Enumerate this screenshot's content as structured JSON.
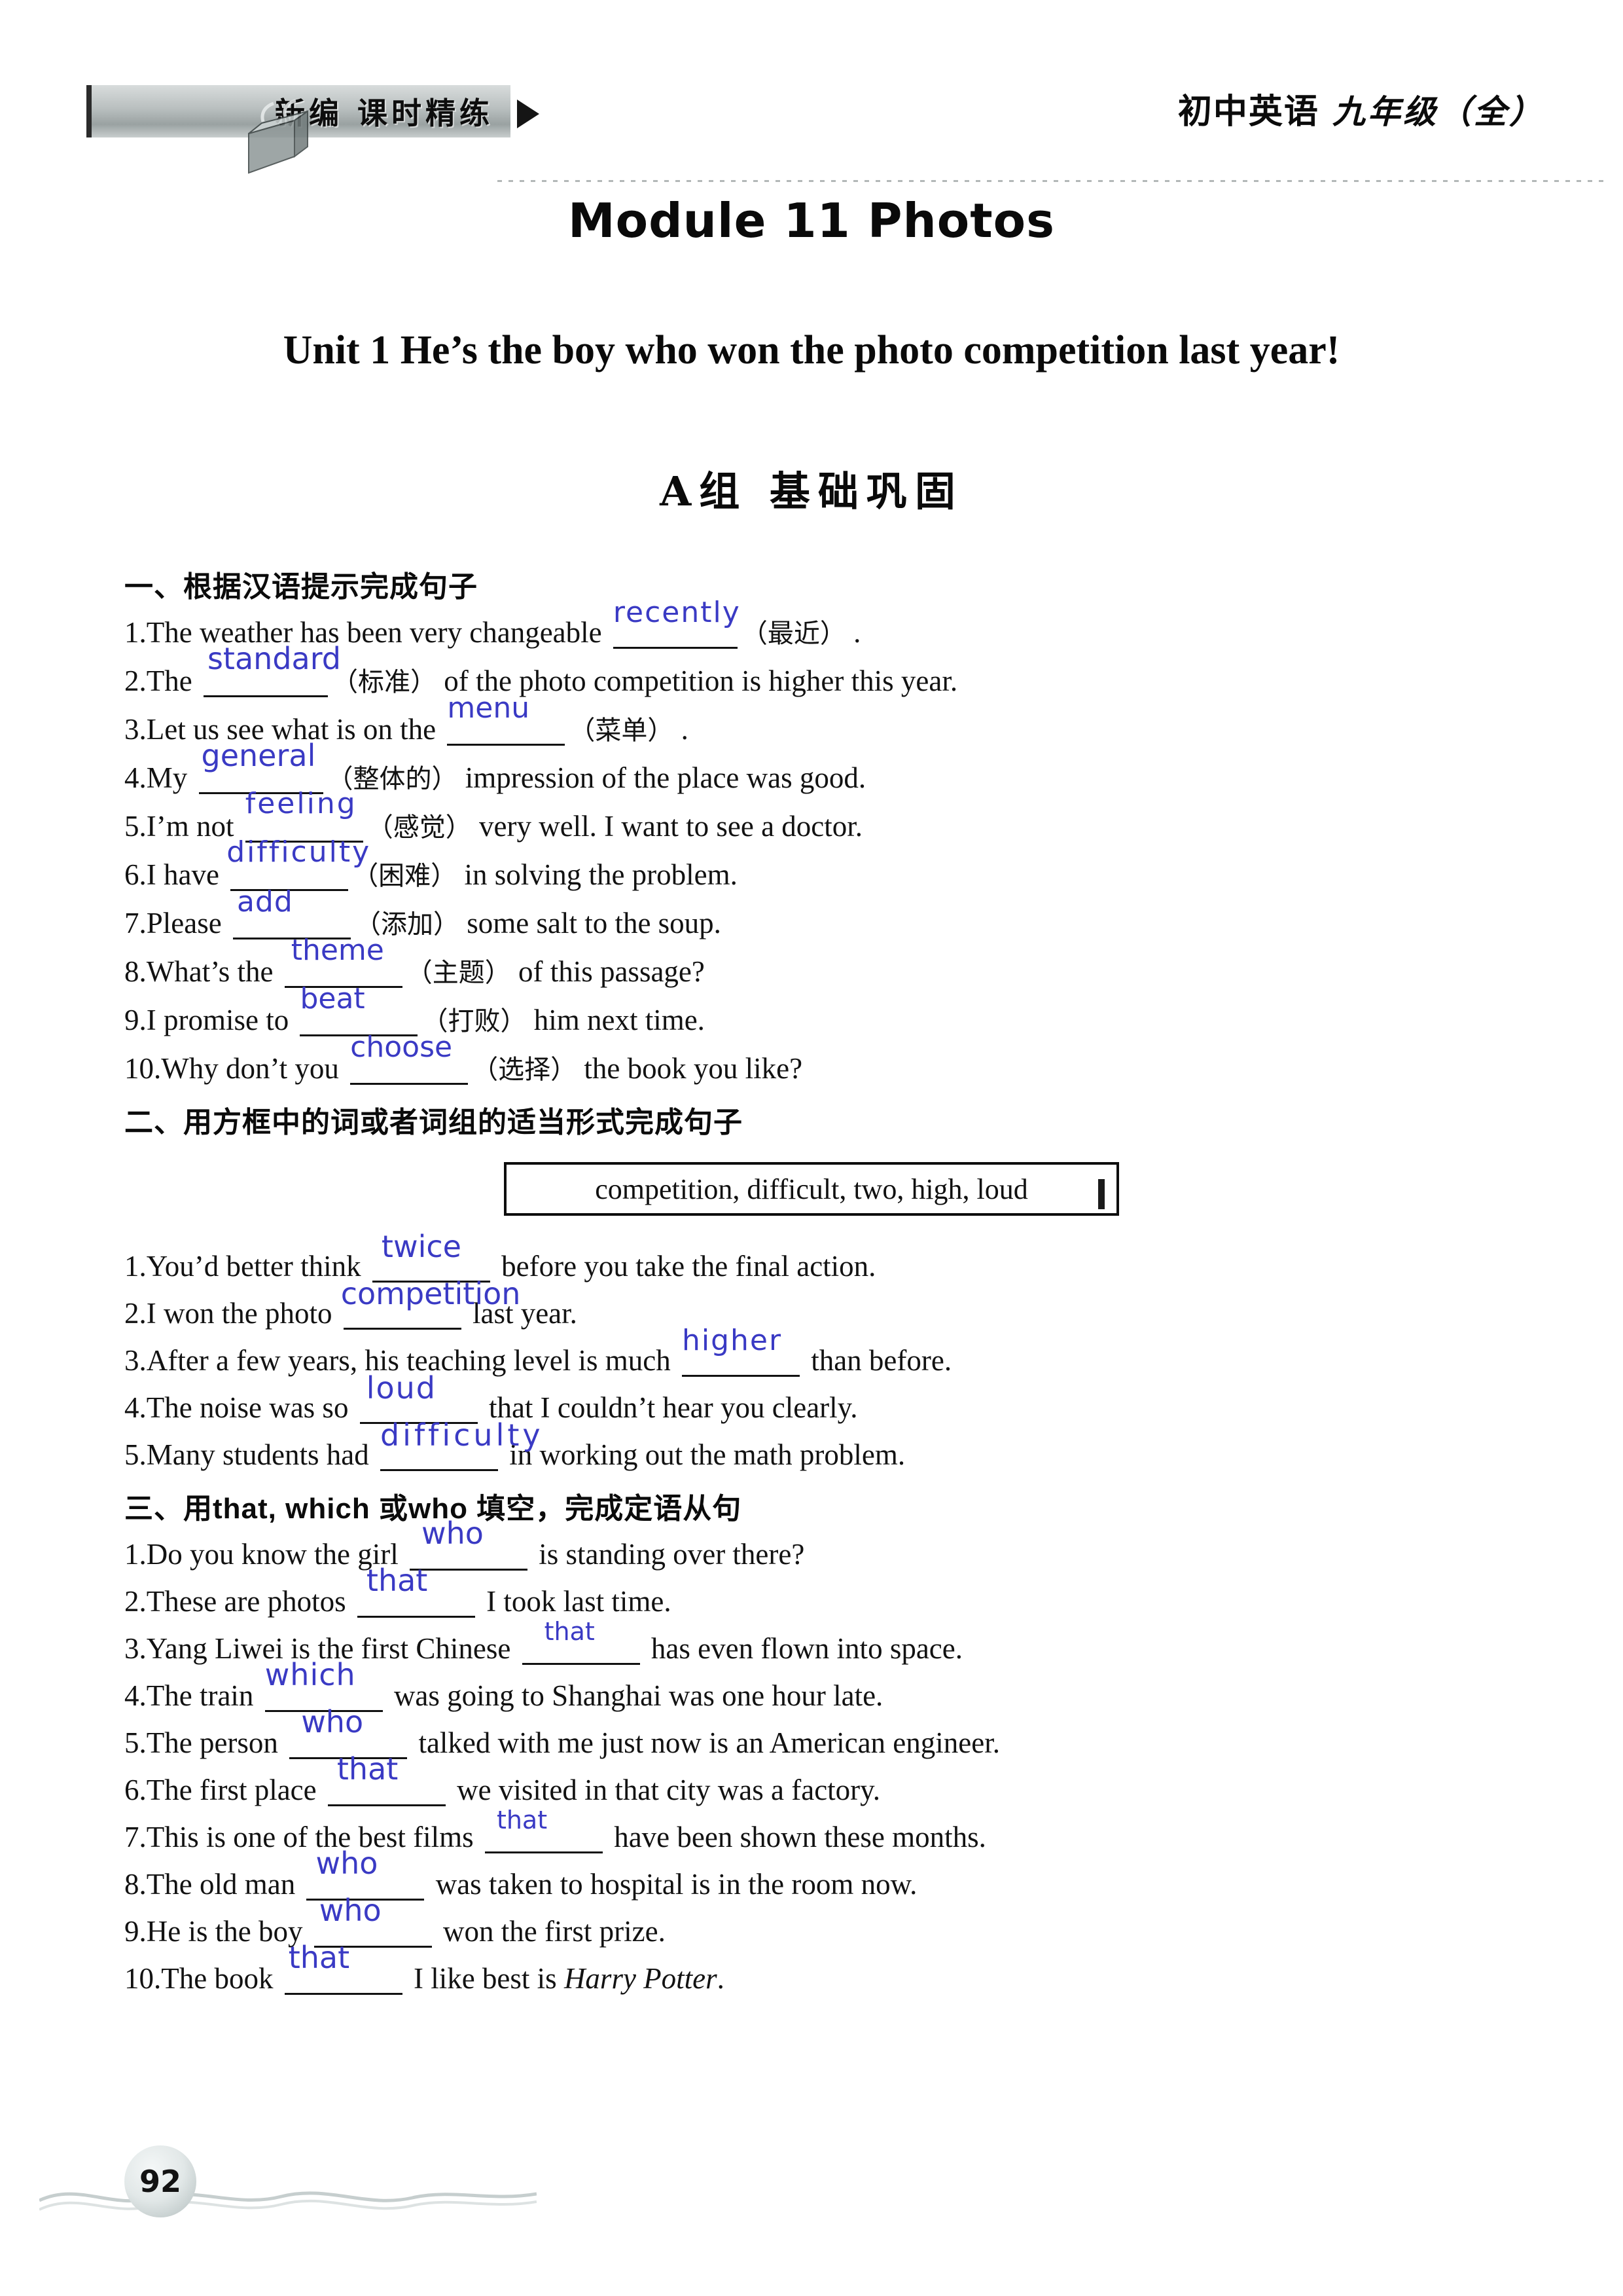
{
  "header": {
    "banner_text": "新编 课时精练",
    "subject": "初中英语",
    "grade": "九年级（全）",
    "logo_icon": "desk-lamp-book-icon",
    "arrow_icon": "triangle-right-icon"
  },
  "titles": {
    "module": "Module 11  Photos",
    "unit": "Unit 1  He’s the boy who won the photo competition last year!",
    "group": "A组 基础巩固"
  },
  "section1": {
    "heading": "一、根据汉语提示完成句子",
    "items": [
      {
        "num": "1.",
        "before": "The weather has been very changeable",
        "answer": "recently",
        "hint": "（最近）",
        "after": "."
      },
      {
        "num": "2.",
        "before": "The",
        "answer": "standard",
        "hint": "（标准）",
        "after": "of the photo competition is higher this year."
      },
      {
        "num": "3.",
        "before": "Let us see what is on the",
        "answer": "menu",
        "hint": "（菜单）",
        "after": "."
      },
      {
        "num": "4.",
        "before": "My",
        "answer": "general",
        "hint": "（整体的）",
        "after": "impression of the place was good."
      },
      {
        "num": "5.",
        "before": "I’m not",
        "answer": "feeling",
        "hint": "（感觉）",
        "after": "very well. I want to see a doctor."
      },
      {
        "num": "6.",
        "before": "I have",
        "answer": "difficulty",
        "hint": "（困难）",
        "after": "in solving the problem."
      },
      {
        "num": "7.",
        "before": "Please",
        "answer": "add",
        "hint": "（添加）",
        "after": "some salt to the soup."
      },
      {
        "num": "8.",
        "before": "What’s the",
        "answer": "theme",
        "hint": "（主题）",
        "after": "of this passage?"
      },
      {
        "num": "9.",
        "before": "I promise to",
        "answer": "beat",
        "hint": "（打败）",
        "after": "him next time."
      },
      {
        "num": "10.",
        "before": "Why don’t you",
        "answer": "choose",
        "hint": "（选择）",
        "after": "the book you like?"
      }
    ]
  },
  "section2": {
    "heading": "二、用方框中的词或者词组的适当形式完成句子",
    "wordbank": "competition, difficult, two, high, loud",
    "items": [
      {
        "num": "1.",
        "before": "You’d better think",
        "answer": "twice",
        "after": "before you take the final action."
      },
      {
        "num": "2.",
        "before": "I won the photo",
        "answer": "competition",
        "after": "last year."
      },
      {
        "num": "3.",
        "before": "After a few years, his teaching level is much",
        "answer": "higher",
        "after": "than before."
      },
      {
        "num": "4.",
        "before": "The noise was so",
        "answer": "loud",
        "after": "that I couldn’t hear you clearly."
      },
      {
        "num": "5.",
        "before": "Many students had",
        "answer": "difficulty",
        "after": "in working out the math problem."
      }
    ]
  },
  "section3": {
    "heading_cn1": "三、用",
    "heading_lat1": "that, which ",
    "heading_cn2": "或",
    "heading_lat2": "who ",
    "heading_cn3": "填空，完成定语从句",
    "items": [
      {
        "num": "1.",
        "before": "Do you know the girl",
        "answer": "who",
        "after": "is standing over there?"
      },
      {
        "num": "2.",
        "before": "These are photos",
        "answer": "that",
        "after": "I took last time."
      },
      {
        "num": "3.",
        "before": "Yang Liwei is the first Chinese",
        "answer": "that",
        "after": "has even flown into space."
      },
      {
        "num": "4.",
        "before": "The train",
        "answer": "which",
        "after": "was going to Shanghai was one hour late."
      },
      {
        "num": "5.",
        "before": "The person",
        "answer": "who",
        "after": "talked with me just now is an American engineer."
      },
      {
        "num": "6.",
        "before": "The first place",
        "answer": "that",
        "after": "we visited in that city was a factory."
      },
      {
        "num": "7.",
        "before": "This is one of the best films",
        "answer": "that",
        "after": "have been shown these months."
      },
      {
        "num": "8.",
        "before": "The old man",
        "answer": "who",
        "after": "was taken to hospital is in the room now."
      },
      {
        "num": "9.",
        "before": "He is the boy",
        "answer": "who",
        "after": "won the first prize."
      },
      {
        "num": "10.",
        "before": "The book",
        "answer": "that",
        "after_plain": "I like best is ",
        "after_italic": "Harry Potter",
        "after_tail": "."
      }
    ]
  },
  "footer": {
    "page_number": "92",
    "wave_icon": "wave-line-icon",
    "badge_icon": "pebble-circle-icon"
  }
}
